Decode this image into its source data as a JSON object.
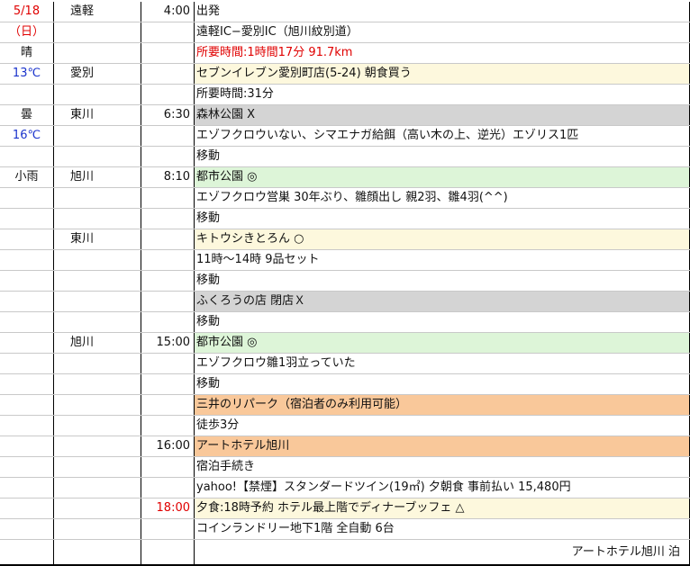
{
  "rows": [
    {
      "date": "5/18",
      "place": "遠軽",
      "time": "4:00",
      "desc": "出発"
    },
    {
      "date": "（日）",
      "place": "",
      "time": "",
      "desc": "遠軽IC−愛別IC（旭川紋別道）"
    },
    {
      "date": "晴",
      "place": "",
      "time": "",
      "desc": "所要時間:1時間17分 91.7km"
    },
    {
      "date": "13℃",
      "place": "愛別",
      "time": "",
      "desc": "セブンイレブン愛別町店(5-24) 朝食買う"
    },
    {
      "date": "",
      "place": "",
      "time": "",
      "desc": "所要時間:31分"
    },
    {
      "date": "曇",
      "place": "東川",
      "time": "6:30",
      "desc": "森林公園 X"
    },
    {
      "date": "16℃",
      "place": "",
      "time": "",
      "desc": "エゾフクロウいない、シマエナガ給餌（高い木の上、逆光）エゾリス1匹"
    },
    {
      "date": "",
      "place": "",
      "time": "",
      "desc": "移動"
    },
    {
      "date": "小雨",
      "place": "旭川",
      "time": "8:10",
      "desc": "都市公園 ◎"
    },
    {
      "date": "",
      "place": "",
      "time": "",
      "desc": "エゾフクロウ営巣 30年ぶり、雛顔出し 親2羽、雛4羽(^^)"
    },
    {
      "date": "",
      "place": "",
      "time": "",
      "desc": "移動"
    },
    {
      "date": "",
      "place": "東川",
      "time": "",
      "desc": "キトウシきとろん ○"
    },
    {
      "date": "",
      "place": "",
      "time": "",
      "desc": "11時〜14時 9品セット"
    },
    {
      "date": "",
      "place": "",
      "time": "",
      "desc": "移動"
    },
    {
      "date": "",
      "place": "",
      "time": "",
      "desc": "ふくろうの店 閉店Ｘ"
    },
    {
      "date": "",
      "place": "",
      "time": "",
      "desc": "移動"
    },
    {
      "date": "",
      "place": "旭川",
      "time": "15:00",
      "desc": "都市公園 ◎"
    },
    {
      "date": "",
      "place": "",
      "time": "",
      "desc": "エゾフクロウ雛1羽立っていた"
    },
    {
      "date": "",
      "place": "",
      "time": "",
      "desc": "移動"
    },
    {
      "date": "",
      "place": "",
      "time": "",
      "desc": "三井のリパーク（宿泊者のみ利用可能）"
    },
    {
      "date": "",
      "place": "",
      "time": "",
      "desc": "徒歩3分"
    },
    {
      "date": "",
      "place": "",
      "time": "16:00",
      "desc": "アートホテル旭川"
    },
    {
      "date": "",
      "place": "",
      "time": "",
      "desc": "宿泊手続き"
    },
    {
      "date": "",
      "place": "",
      "time": "",
      "desc": "yahoo!【禁煙】スタンダードツイン(19㎡) 夕朝食 事前払い 15,480円"
    },
    {
      "date": "",
      "place": "",
      "time": "18:00",
      "desc": "夕食:18時予約 ホテル最上階でディナーブッフェ △"
    },
    {
      "date": "",
      "place": "",
      "time": "",
      "desc": "コインランドリー地下1階 全自動 6台"
    }
  ],
  "footer": "アートホテル旭川 泊",
  "colors": {
    "red": "#e00000",
    "blue": "#1a33cc",
    "yellow": "#fdf8dd",
    "gray": "#d4d4d4",
    "green": "#ddf5d8",
    "orange": "#f9c89a"
  }
}
